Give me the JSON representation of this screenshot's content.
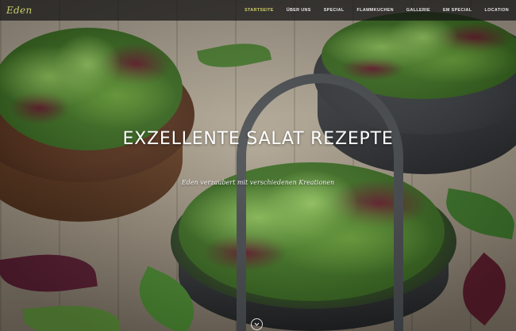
{
  "brand": {
    "logo_text": "Eden"
  },
  "nav": {
    "items": [
      {
        "label": "STARTSEITE",
        "active": true
      },
      {
        "label": "ÜBER UNS",
        "active": false
      },
      {
        "label": "SPECIAL",
        "active": false
      },
      {
        "label": "FLAMMKUCHEN",
        "active": false
      },
      {
        "label": "GALLERIE",
        "active": false
      },
      {
        "label": "EM SPECIAL",
        "active": false
      },
      {
        "label": "LOCATION",
        "active": false
      }
    ]
  },
  "hero": {
    "title": "EXZELLENTE SALAT REZEPTE",
    "subtitle": "Eden verzaubert mit verschiedenen Kreationen"
  },
  "icons": {
    "scroll": "chevron-down-icon"
  },
  "colors": {
    "accent": "#cfd26b",
    "navbar_bg": "#141414",
    "text": "#ffffff"
  }
}
